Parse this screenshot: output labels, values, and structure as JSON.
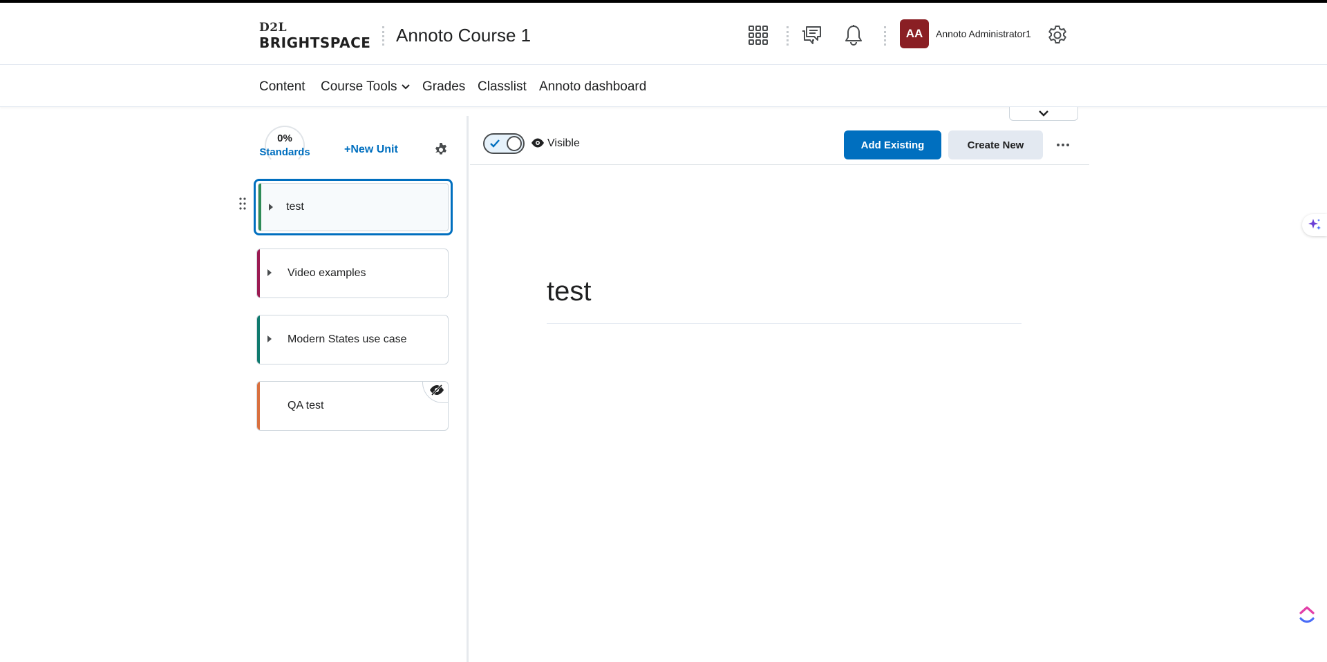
{
  "header": {
    "logo_top": "D2L",
    "logo_main": "BRIGHTSPACE",
    "course_title": "Annoto Course 1",
    "user_initials": "AA",
    "user_name": "Annoto Administrator1",
    "icons": [
      "app-grid-icon",
      "message-icon",
      "bell-icon",
      "gear-icon"
    ],
    "avatar_color": "#8a1f24"
  },
  "nav": {
    "items": [
      {
        "label": "Content"
      },
      {
        "label": "Course Tools",
        "has_dropdown": true
      },
      {
        "label": "Grades"
      },
      {
        "label": "Classlist"
      },
      {
        "label": "Annoto dashboard"
      }
    ]
  },
  "sidebar": {
    "progress": "0%",
    "standards_label": "Standards",
    "new_unit_label": "New Unit",
    "units": [
      {
        "label": "test",
        "color": "#2e8b57",
        "selected": true,
        "expandable": true
      },
      {
        "label": "Video examples",
        "color": "#9b1b52",
        "selected": false,
        "expandable": true
      },
      {
        "label": "Modern States use case",
        "color": "#0f7a6e",
        "selected": false,
        "expandable": true
      },
      {
        "label": "QA test",
        "color": "#d9703f",
        "selected": false,
        "expandable": false,
        "hidden": true
      }
    ]
  },
  "main": {
    "visible_label": "Visible",
    "visible_on": true,
    "add_existing_label": "Add Existing",
    "create_new_label": "Create New",
    "unit_title": "test"
  },
  "theme": {
    "primary": "#006fbf",
    "secondary_bg": "#e3e9f1",
    "text": "#202122"
  }
}
